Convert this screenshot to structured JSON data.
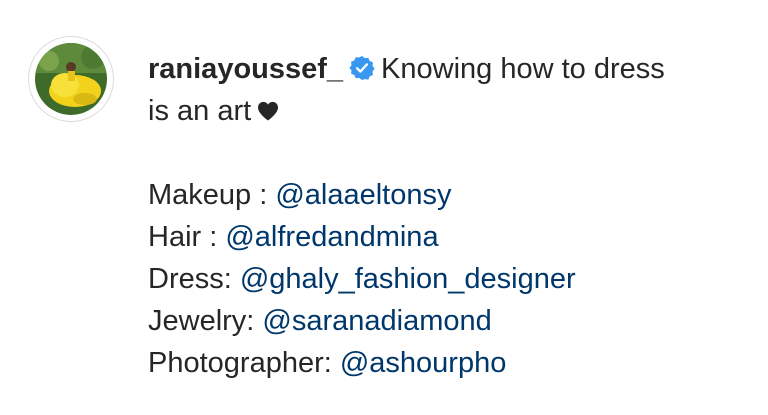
{
  "post": {
    "username": "raniayoussef_",
    "verified_icon": "verified-badge-icon",
    "caption_line1": "Knowing how to dress",
    "caption_line2": "is an art",
    "heart_icon": "black-heart-icon",
    "credits": [
      {
        "label": "Makeup : ",
        "mention": "@alaaeltonsy"
      },
      {
        "label": "Hair : ",
        "mention": "@alfredandmina"
      },
      {
        "label": "Dress: ",
        "mention": "@ghaly_fashion_designer"
      },
      {
        "label": "Jewelry: ",
        "mention": "@saranadiamond"
      },
      {
        "label": "Photographer: ",
        "mention": "@ashourpho"
      }
    ]
  },
  "colors": {
    "text": "#262626",
    "mention": "#00376b",
    "verified": "#3897f0"
  }
}
